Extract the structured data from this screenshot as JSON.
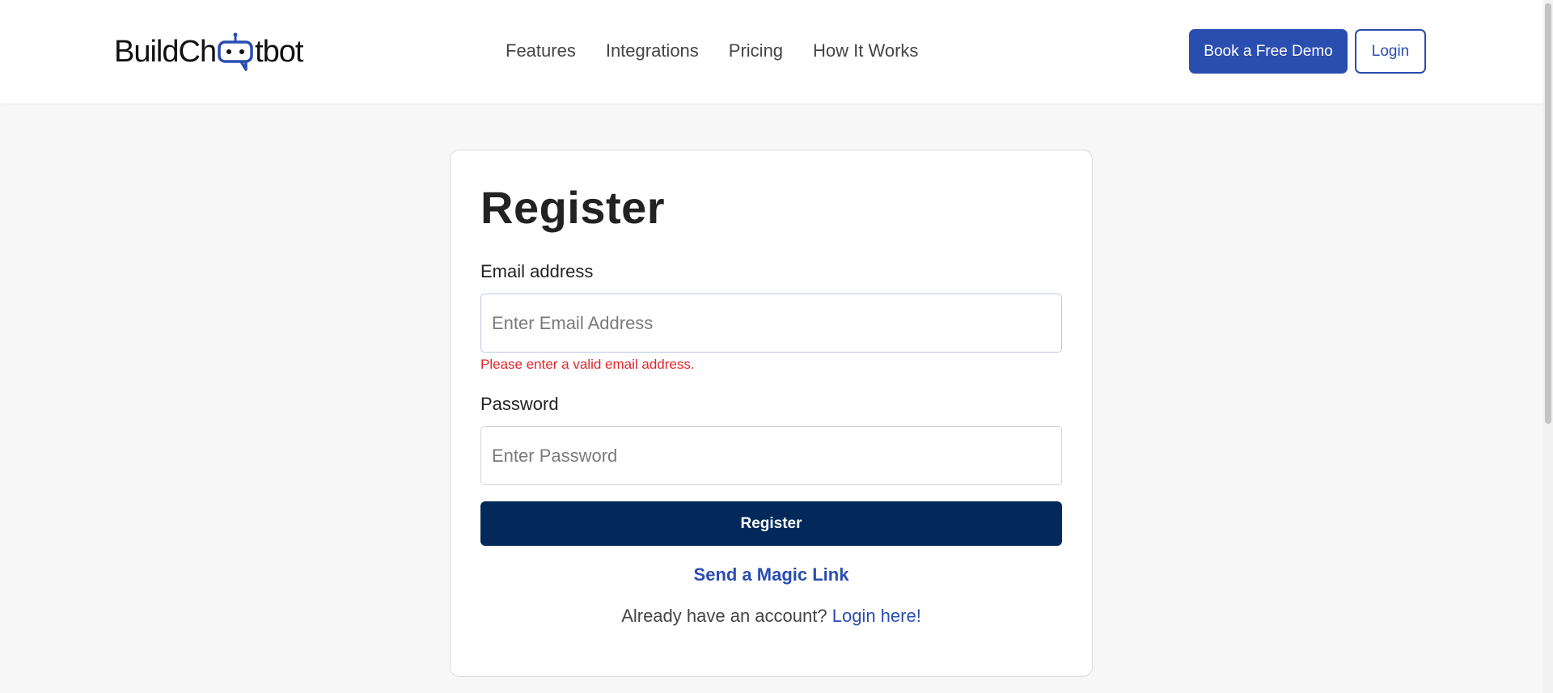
{
  "header": {
    "logo": {
      "text_before": "BuildCh",
      "text_after": "tbot",
      "icon": "chat-bot-icon"
    },
    "nav": [
      "Features",
      "Integrations",
      "Pricing",
      "How It Works"
    ],
    "demo_button": "Book a Free Demo",
    "login_button": "Login"
  },
  "form": {
    "title": "Register",
    "email_label": "Email address",
    "email_placeholder": "Enter Email Address",
    "email_error": "Please enter a valid email address.",
    "password_label": "Password",
    "password_placeholder": "Enter Password",
    "submit_label": "Register",
    "magic_link": "Send a Magic Link",
    "already_text": "Already have an account?",
    "login_link": "Login here!"
  },
  "colors": {
    "brand": "#2a4db0",
    "primary_button": "#02295a",
    "error": "#e0262b"
  }
}
